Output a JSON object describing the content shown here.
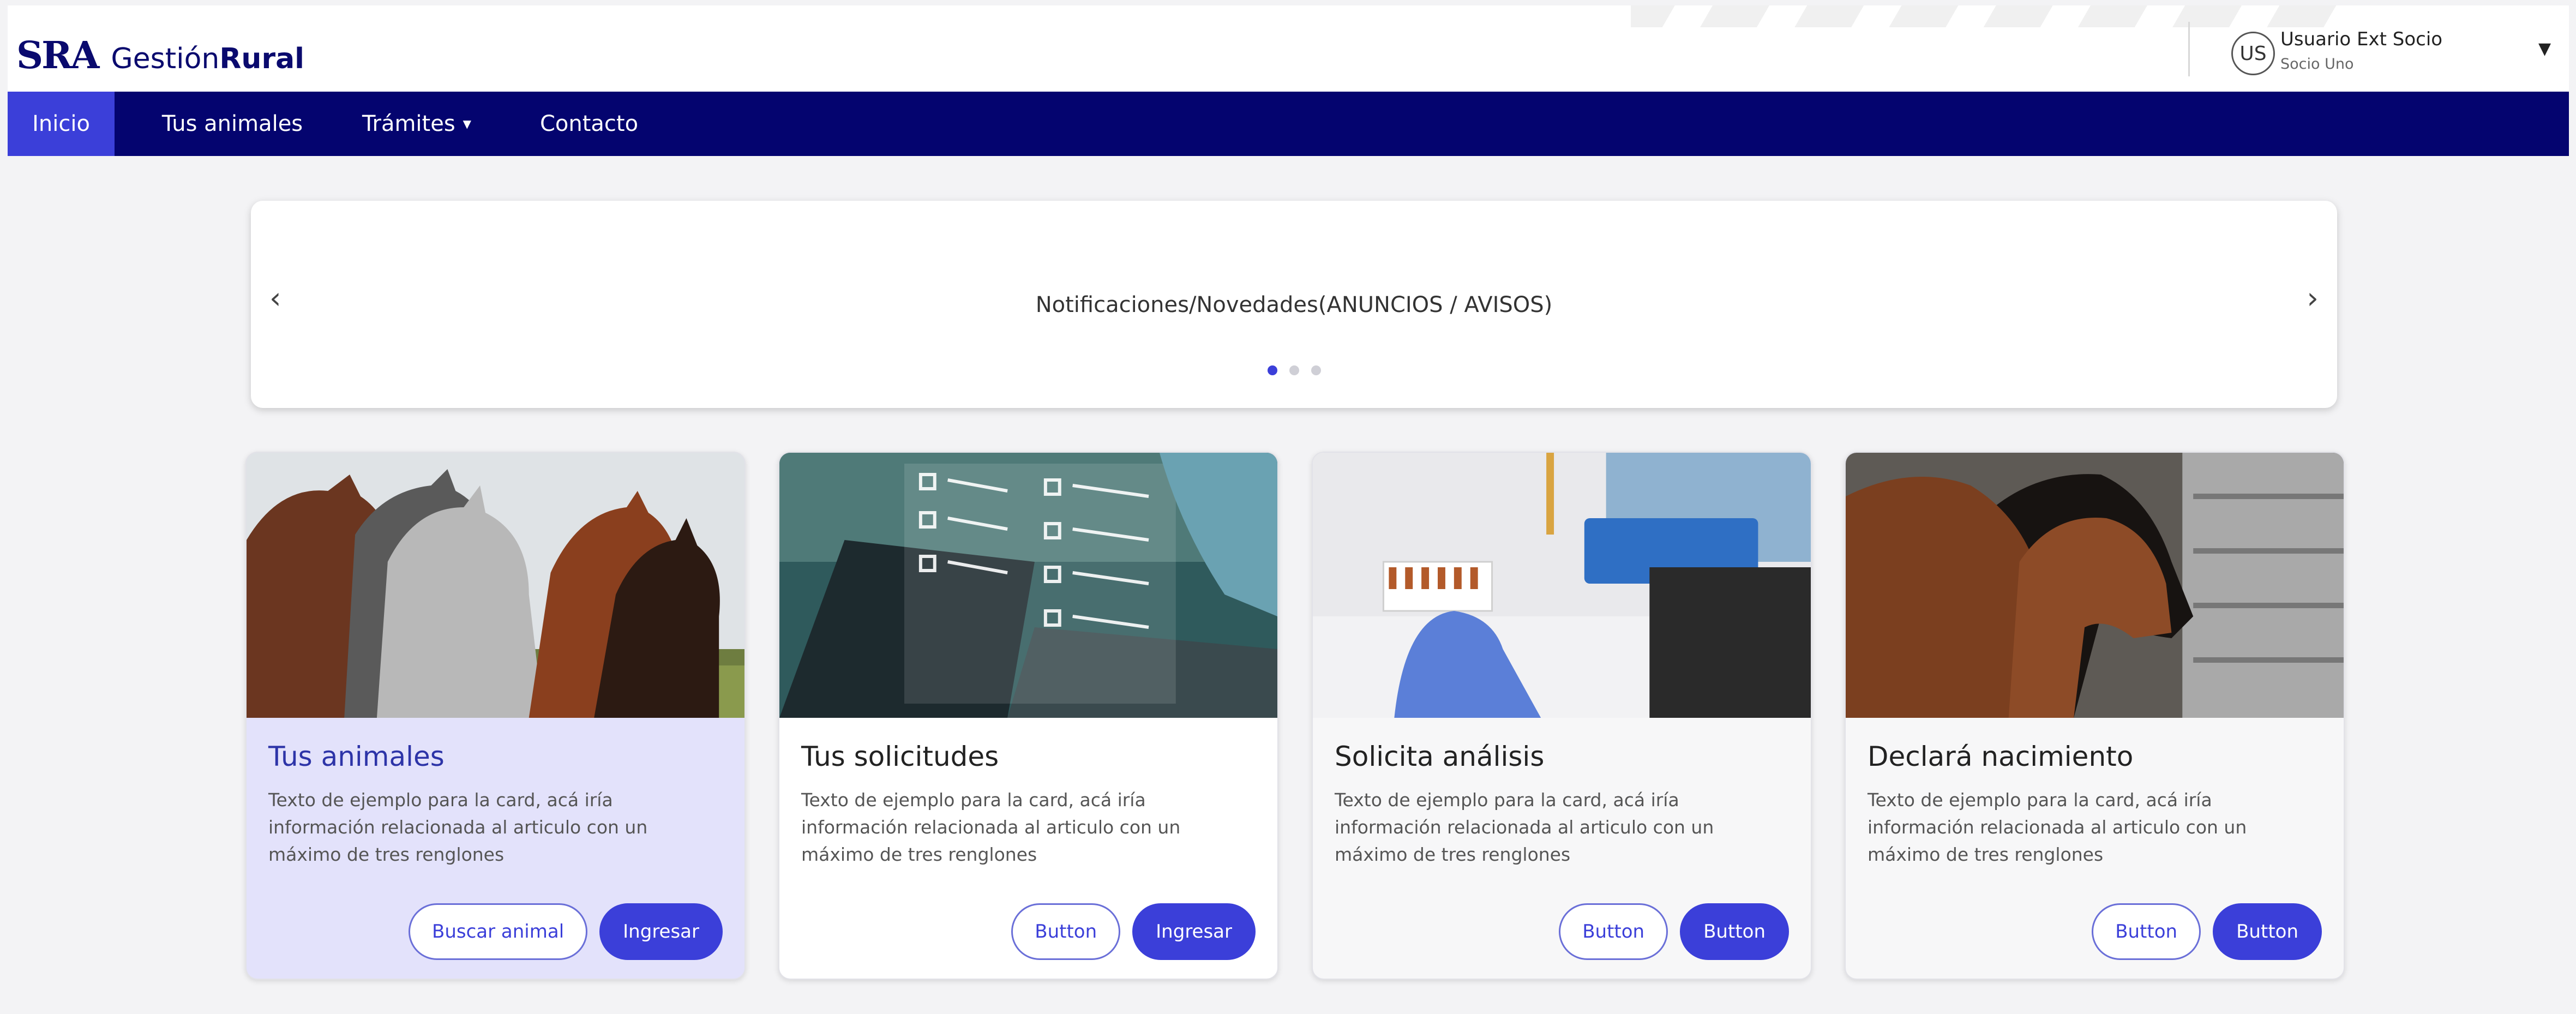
{
  "header": {
    "logo": {
      "sra": "SRA",
      "gestion": "Gestión",
      "rural": "Rural"
    },
    "user": {
      "initials": "US",
      "name": "Usuario Ext Socio",
      "role": "Socio Uno",
      "caret_icon": "caret-down-icon"
    }
  },
  "nav": {
    "items": [
      {
        "label": "Inicio",
        "active": true
      },
      {
        "label": "Tus animales"
      },
      {
        "label": "Trámites",
        "has_dropdown": true
      },
      {
        "label": "Contacto"
      }
    ],
    "background_color": "#04046f",
    "active_color": "#3b3fd9"
  },
  "carousel": {
    "text": "Notificaciones/Novedades(ANUNCIOS / AVISOS)",
    "prev_icon": "chevron-left-icon",
    "next_icon": "chevron-right-icon",
    "prev_glyph": "‹",
    "next_glyph": "›",
    "dot_count": 3,
    "active_dot": 1
  },
  "cards": [
    {
      "image": "horses-photo",
      "title": "Tus animales",
      "text": "Texto de ejemplo para la card, acá iría información relacionada al articulo con un máximo de tres renglones",
      "secondary_label": "Buscar animal",
      "primary_label": "Ingresar"
    },
    {
      "image": "checklist-laptop-photo",
      "title": "Tus solicitudes",
      "text": "Texto de ejemplo para la card, acá iría información relacionada al articulo con un máximo de tres renglones",
      "secondary_label": "Button",
      "primary_label": "Ingresar"
    },
    {
      "image": "lab-analysis-photo",
      "title": "Solicita análisis",
      "text": "Texto de ejemplo para la card, acá iría información relacionada al articulo con un máximo de tres renglones",
      "secondary_label": "Button",
      "primary_label": "Button"
    },
    {
      "image": "cattle-photo",
      "title": "Declará nacimiento",
      "text": "Texto de ejemplo para la card, acá iría información relacionada al articulo con un máximo de tres renglones",
      "secondary_label": "Button",
      "primary_label": "Button"
    }
  ],
  "colors": {
    "brand_navy": "#0a0a6e",
    "primary_button": "#3b3fd9",
    "highlight_card": "#e3e2fb"
  }
}
